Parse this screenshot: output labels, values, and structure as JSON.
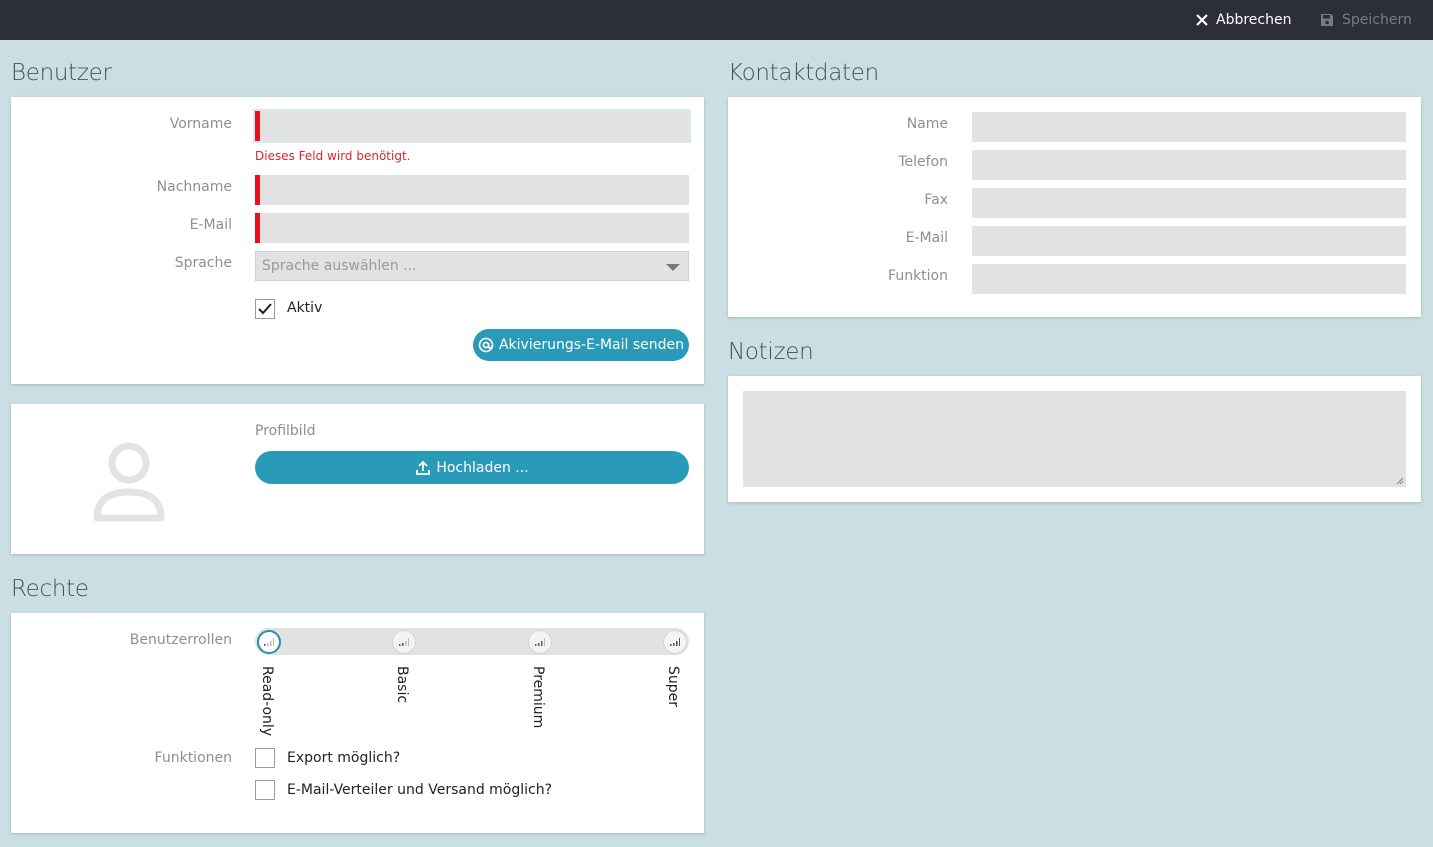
{
  "toolbar": {
    "cancel_label": "Abbrechen",
    "save_label": "Speichern"
  },
  "benutzer": {
    "title": "Benutzer",
    "vorname_label": "Vorname",
    "vorname_value": "",
    "vorname_error": "Dieses Feld wird benötigt.",
    "nachname_label": "Nachname",
    "nachname_value": "",
    "email_label": "E-Mail",
    "email_value": "",
    "sprache_label": "Sprache",
    "sprache_placeholder": "Sprache auswählen ...",
    "aktiv_label": "Aktiv",
    "aktiv_checked": true,
    "activation_button": "Akivierungs-E-Mail senden"
  },
  "profilbild": {
    "label": "Profilbild",
    "upload_button": "Hochladen ..."
  },
  "rechte": {
    "title": "Rechte",
    "rollen_label": "Benutzerrollen",
    "roles": [
      "Read-only",
      "Basic",
      "Premium",
      "Super"
    ],
    "selected_role": "Read-only",
    "funktionen_label": "Funktionen",
    "functions": [
      {
        "label": "Export möglich?",
        "checked": false
      },
      {
        "label": "E-Mail-Verteiler und Versand möglich?",
        "checked": false
      }
    ]
  },
  "kontakt": {
    "title": "Kontaktdaten",
    "name_label": "Name",
    "telefon_label": "Telefon",
    "fax_label": "Fax",
    "email_label": "E-Mail",
    "funktion_label": "Funktion"
  },
  "notizen": {
    "title": "Notizen",
    "value": ""
  },
  "colors": {
    "accent": "#2a9ab9",
    "required": "#e8101a",
    "topbar": "#2c2f3a",
    "background": "#c9dfe3"
  }
}
